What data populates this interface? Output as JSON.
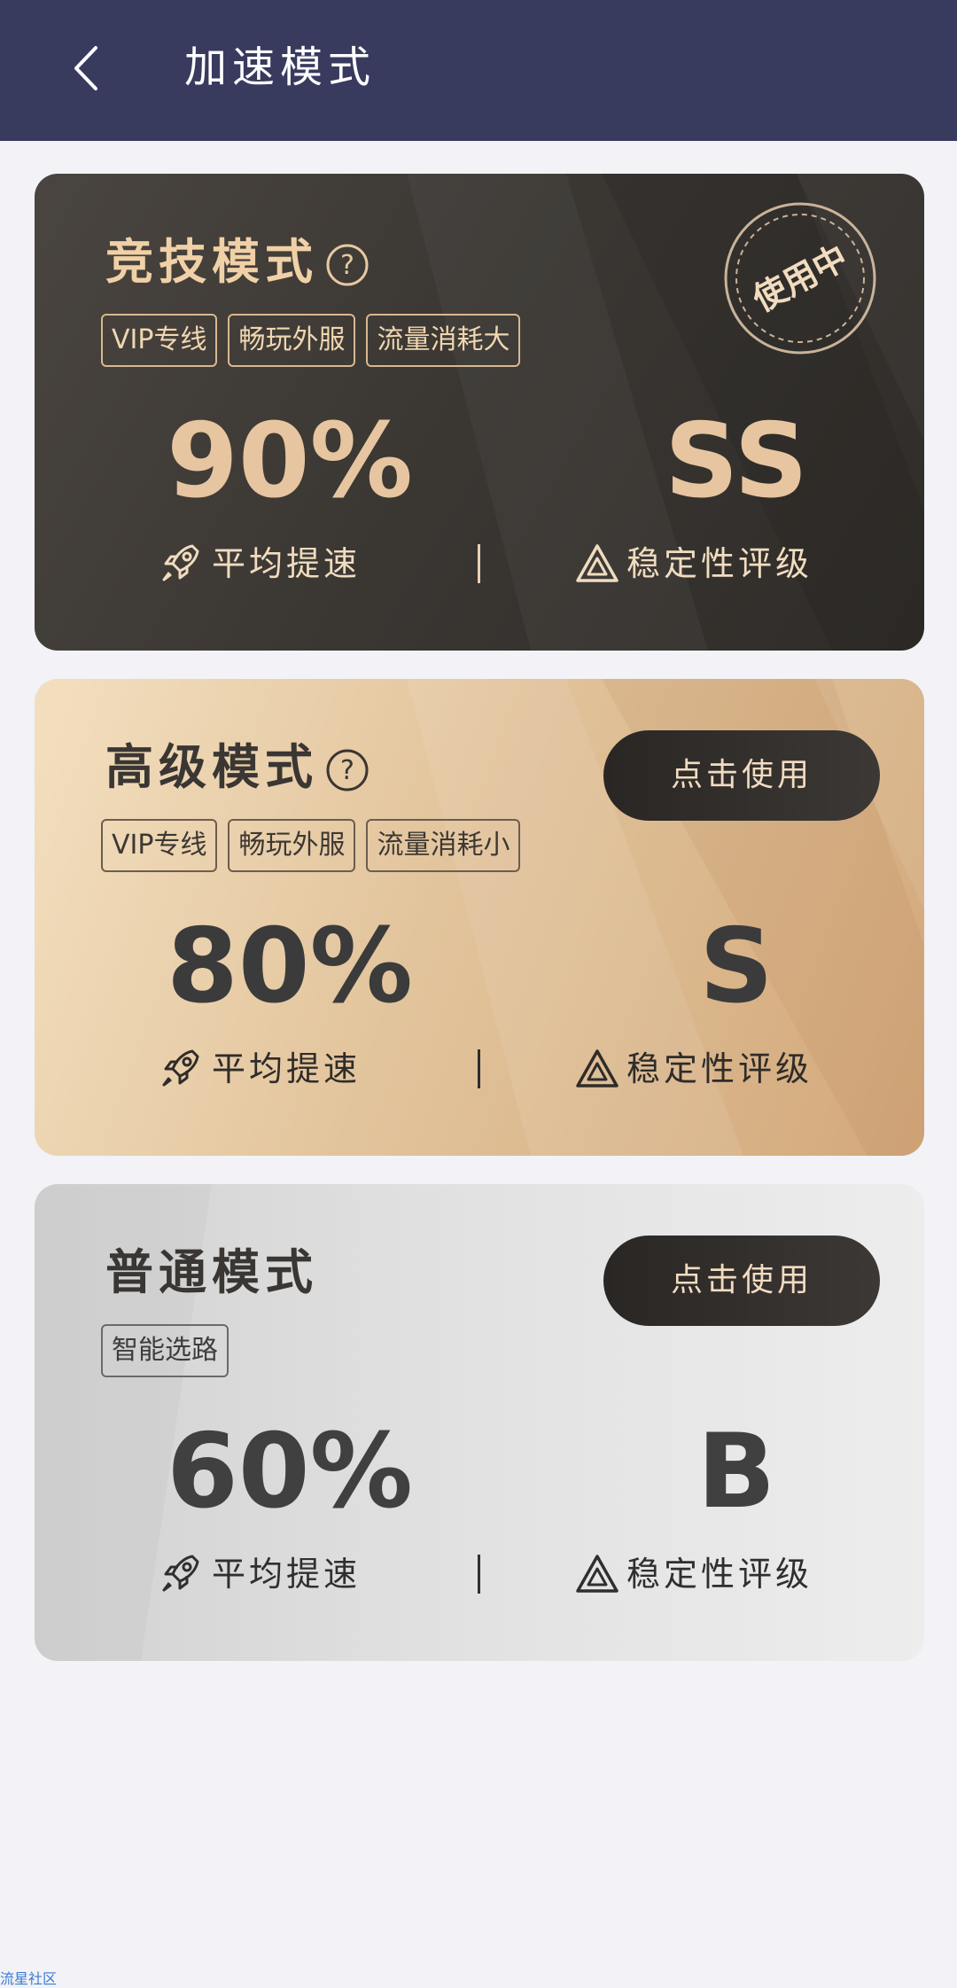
{
  "header": {
    "title": "加速模式"
  },
  "cards": [
    {
      "title": "竞技模式",
      "tags": [
        "VIP专线",
        "畅玩外服",
        "流量消耗大"
      ],
      "speed_value": "90%",
      "speed_label": "平均提速",
      "rating_value": "SS",
      "rating_label": "稳定性评级",
      "status": "使用中"
    },
    {
      "title": "高级模式",
      "tags": [
        "VIP专线",
        "畅玩外服",
        "流量消耗小"
      ],
      "speed_value": "80%",
      "speed_label": "平均提速",
      "rating_value": "S",
      "rating_label": "稳定性评级",
      "button_label": "点击使用"
    },
    {
      "title": "普通模式",
      "tags": [
        "智能选路"
      ],
      "speed_value": "60%",
      "speed_label": "平均提速",
      "rating_value": "B",
      "rating_label": "稳定性评级",
      "button_label": "点击使用"
    }
  ],
  "footer": {
    "watermark": "流星社区"
  },
  "colors": {
    "header_bg": "#383a5e",
    "page_bg": "#f2f2f7",
    "gold_text": "#f0d0a6",
    "dark_button": "#2a2624"
  },
  "icons": {
    "back": "chevron-left-icon",
    "help": "question-circle-icon",
    "speed": "rocket-icon",
    "rating": "warning-triangle-icon"
  }
}
